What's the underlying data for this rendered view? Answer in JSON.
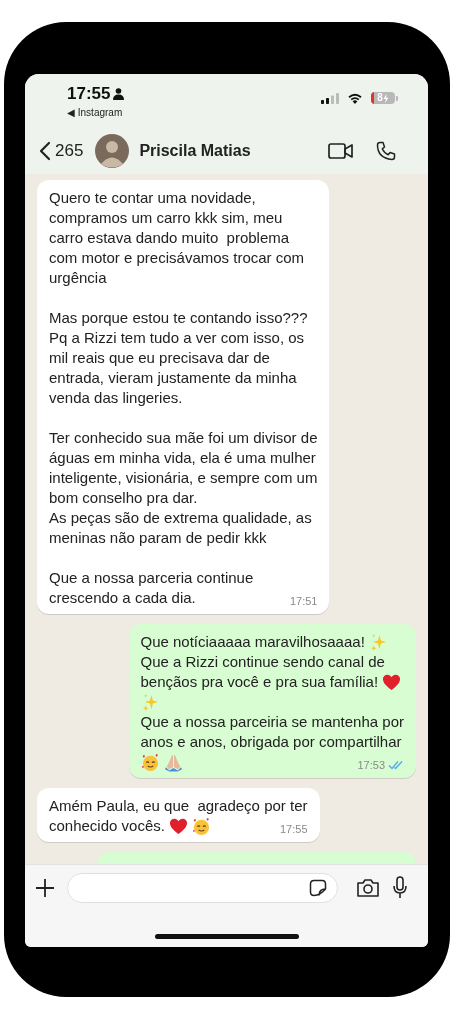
{
  "status_bar": {
    "time": "17:55",
    "back_app": "◀ Instagram",
    "battery": "8"
  },
  "header": {
    "back_count": "265",
    "contact_name": "Priscila Matias"
  },
  "messages": [
    {
      "kind": "incoming",
      "time": "17:51",
      "paragraphs": [
        [
          [
            {
              "kind": "text",
              "text": "Quero te contar uma novidade,"
            }
          ],
          [
            {
              "kind": "text",
              "text": "compramos um carro kkk sim, meu"
            }
          ],
          [
            {
              "kind": "text",
              "text": "carro estava dando muito  problema"
            }
          ],
          [
            {
              "kind": "text",
              "text": "com motor e precisávamos trocar com"
            }
          ],
          [
            {
              "kind": "text",
              "text": "urgência"
            }
          ]
        ],
        [
          [
            {
              "kind": "text",
              "text": "Mas porque estou te contando isso???"
            }
          ],
          [
            {
              "kind": "text",
              "text": "Pq a Rizzi tem tudo a ver com isso, os"
            }
          ],
          [
            {
              "kind": "text",
              "text": "mil reais que eu precisava dar de"
            }
          ],
          [
            {
              "kind": "text",
              "text": "entrada, vieram justamente da minha"
            }
          ],
          [
            {
              "kind": "text",
              "text": "venda das lingeries."
            }
          ]
        ],
        [
          [
            {
              "kind": "text",
              "text": "Ter conhecido sua mãe foi um divisor de"
            }
          ],
          [
            {
              "kind": "text",
              "text": "águas em minha vida, ela é uma mulher"
            }
          ],
          [
            {
              "kind": "text",
              "text": "inteligente, visionária, e sempre com um"
            }
          ],
          [
            {
              "kind": "text",
              "text": "bom conselho pra dar."
            }
          ],
          [
            {
              "kind": "text",
              "text": "As peças são de extrema qualidade, as"
            }
          ],
          [
            {
              "kind": "text",
              "text": "meninas não param de pedir kkk"
            }
          ]
        ],
        [
          [
            {
              "kind": "text",
              "text": "Que a nossa parceria continue"
            }
          ],
          [
            {
              "kind": "text",
              "text": "crescendo a cada dia."
            }
          ]
        ]
      ]
    },
    {
      "kind": "outgoing",
      "time": "17:53",
      "read": true,
      "paragraphs": [
        [
          [
            {
              "kind": "text",
              "text": "Que notíciaaaaa maravilhosaaaa!"
            },
            {
              "kind": "sparkles"
            }
          ],
          [
            {
              "kind": "text",
              "text": "Que a Rizzi continue sendo canal de"
            }
          ],
          [
            {
              "kind": "text",
              "text": "bençãos pra você e pra sua família!"
            },
            {
              "kind": "heart"
            }
          ],
          [
            {
              "kind": "sparkles"
            }
          ],
          [
            {
              "kind": "text",
              "text": "Que a nossa parceiria se mantenha por"
            }
          ],
          [
            {
              "kind": "text",
              "text": "anos e anos, obrigada por compartilhar"
            }
          ],
          [
            {
              "kind": "smiling-hearts"
            },
            {
              "kind": "pray"
            }
          ]
        ]
      ]
    },
    {
      "kind": "incoming",
      "time": "17:55",
      "paragraphs": [
        [
          [
            {
              "kind": "text",
              "text": "Amém Paula, eu que  agradeço por ter"
            }
          ],
          [
            {
              "kind": "text",
              "text": "conhecido vocês."
            },
            {
              "kind": "heart"
            },
            {
              "kind": "smiling-hearts"
            }
          ]
        ]
      ]
    },
    {
      "kind": "outgoing_cut"
    }
  ]
}
